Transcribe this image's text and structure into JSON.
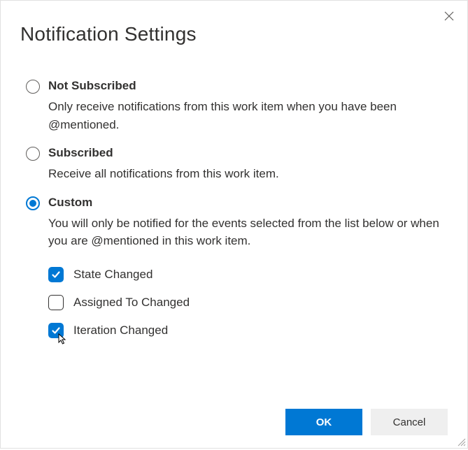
{
  "dialog": {
    "title": "Notification Settings"
  },
  "options": {
    "not_subscribed": {
      "label": "Not Subscribed",
      "desc": "Only receive notifications from this work item when you have been @mentioned.",
      "selected": false
    },
    "subscribed": {
      "label": "Subscribed",
      "desc": "Receive all notifications from this work item.",
      "selected": false
    },
    "custom": {
      "label": "Custom",
      "desc": "You will only be notified for the events selected from the list below or when you are @mentioned in this work item.",
      "selected": true
    }
  },
  "custom_events": {
    "state_changed": {
      "label": "State Changed",
      "checked": true
    },
    "assigned_to_changed": {
      "label": "Assigned To Changed",
      "checked": false
    },
    "iteration_changed": {
      "label": "Iteration Changed",
      "checked": true
    }
  },
  "buttons": {
    "ok": "OK",
    "cancel": "Cancel"
  }
}
